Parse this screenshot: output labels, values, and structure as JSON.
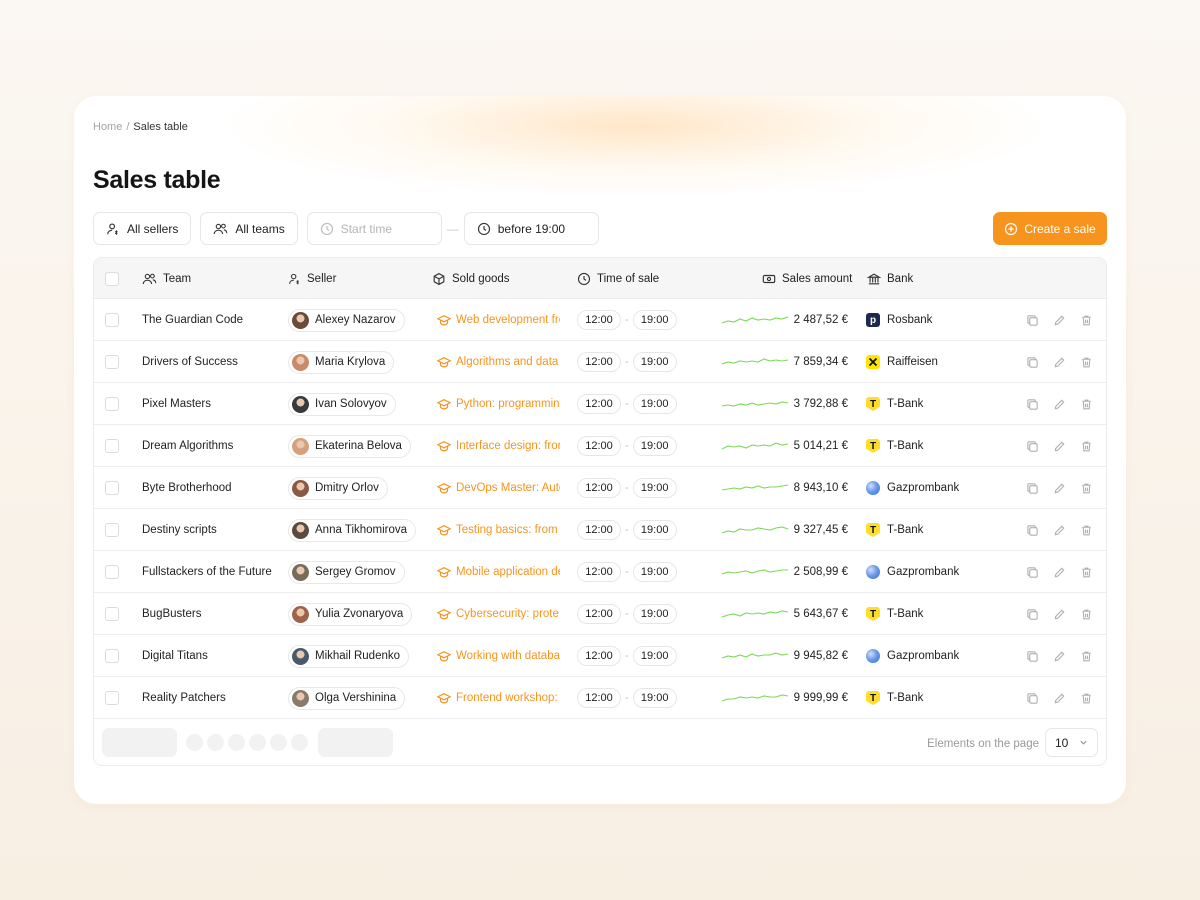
{
  "breadcrumb": {
    "home": "Home",
    "separator": "/",
    "current": "Sales table"
  },
  "page_title": "Sales table",
  "filters": {
    "sellers": "All sellers",
    "teams": "All teams",
    "start_time_placeholder": "Start time",
    "range_separator": "—",
    "end_time": "before 19:00"
  },
  "create_button": "Create a sale",
  "table": {
    "headers": {
      "team": "Team",
      "seller": "Seller",
      "goods": "Sold goods",
      "time": "Time of sale",
      "amount": "Sales amount",
      "bank": "Bank"
    },
    "rows": [
      {
        "team": "The Guardian Code",
        "seller": "Alexey Nazarov",
        "goods": "Web development from",
        "time_start": "12:00",
        "time_end": "19:00",
        "amount": "2 487,52 €",
        "bank": "Rosbank",
        "bank_icon": "rosbank-icon"
      },
      {
        "team": "Drivers of Success",
        "seller": "Maria Krylova",
        "goods": "Algorithms and data s",
        "time_start": "12:00",
        "time_end": "19:00",
        "amount": "7 859,34 €",
        "bank": "Raiffeisen",
        "bank_icon": "raiffeisen-icon"
      },
      {
        "team": "Pixel Masters",
        "seller": "Ivan Solovyov",
        "goods": "Python: programming",
        "time_start": "12:00",
        "time_end": "19:00",
        "amount": "3 792,88 €",
        "bank": "T-Bank",
        "bank_icon": "tbank-icon"
      },
      {
        "team": "Dream Algorithms",
        "seller": "Ekaterina Belova",
        "goods": "Interface design: from",
        "time_start": "12:00",
        "time_end": "19:00",
        "amount": "5 014,21 €",
        "bank": "T-Bank",
        "bank_icon": "tbank-icon"
      },
      {
        "team": "Byte Brotherhood",
        "seller": "Dmitry Orlov",
        "goods": "DevOps Master: Auto",
        "time_start": "12:00",
        "time_end": "19:00",
        "amount": "8 943,10 €",
        "bank": "Gazprombank",
        "bank_icon": "gazprombank-icon"
      },
      {
        "team": "Destiny scripts",
        "seller": "Anna Tikhomirova",
        "goods": "Testing basics: from t",
        "time_start": "12:00",
        "time_end": "19:00",
        "amount": "9 327,45 €",
        "bank": "T-Bank",
        "bank_icon": "tbank-icon"
      },
      {
        "team": "Fullstackers of the Future",
        "seller": "Sergey Gromov",
        "goods": "Mobile application de",
        "time_start": "12:00",
        "time_end": "19:00",
        "amount": "2 508,99 €",
        "bank": "Gazprombank",
        "bank_icon": "gazprombank-icon"
      },
      {
        "team": "BugBusters",
        "seller": "Yulia Zvonaryova",
        "goods": "Cybersecurity: prote",
        "time_start": "12:00",
        "time_end": "19:00",
        "amount": "5 643,67 €",
        "bank": "T-Bank",
        "bank_icon": "tbank-icon"
      },
      {
        "team": "Digital Titans",
        "seller": "Mikhail Rudenko",
        "goods": "Working with databas",
        "time_start": "12:00",
        "time_end": "19:00",
        "amount": "9 945,82 €",
        "bank": "Gazprombank",
        "bank_icon": "gazprombank-icon"
      },
      {
        "team": "Reality Patchers",
        "seller": "Olga Vershinina",
        "goods": "Frontend workshop: ...",
        "time_start": "12:00",
        "time_end": "19:00",
        "amount": "9 999,99 €",
        "bank": "T-Bank",
        "bank_icon": "tbank-icon"
      }
    ]
  },
  "pagination": {
    "per_page_label": "Elements on the page",
    "per_page_value": "10"
  },
  "colors": {
    "accent": "#f7941d",
    "sparkline": "#7ed957",
    "tbank": "#ffdd2d",
    "rosbank": "#1d2a4d",
    "gazprombank": "#2f6fd6"
  }
}
